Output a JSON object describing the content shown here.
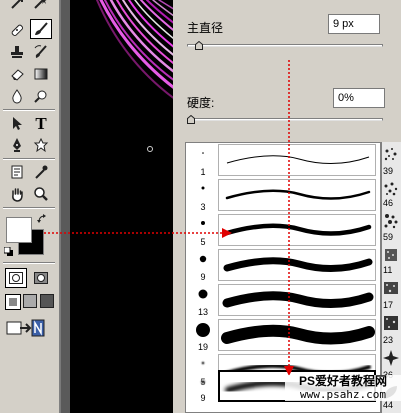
{
  "brush_panel": {
    "diameter_label": "主直径",
    "diameter_value": "9 px",
    "hardness_label": "硬度:",
    "hardness_value": "0%",
    "presets": [
      {
        "size": "1",
        "right_num": "39"
      },
      {
        "size": "3",
        "right_num": "46"
      },
      {
        "size": "5",
        "right_num": "59"
      },
      {
        "size": "9",
        "right_num": "11"
      },
      {
        "size": "13",
        "right_num": "17"
      },
      {
        "size": "19",
        "right_num": "23"
      },
      {
        "size": "5",
        "right_num": "36"
      },
      {
        "size": "9",
        "right_num": "44"
      }
    ],
    "selected_preset_index": 7
  },
  "colors": {
    "arrow": "#e00000",
    "foreground": "#ffffff",
    "background": "#000000"
  },
  "watermark": {
    "title": "PS爱好者教程网",
    "url": "www.psahz.com"
  }
}
